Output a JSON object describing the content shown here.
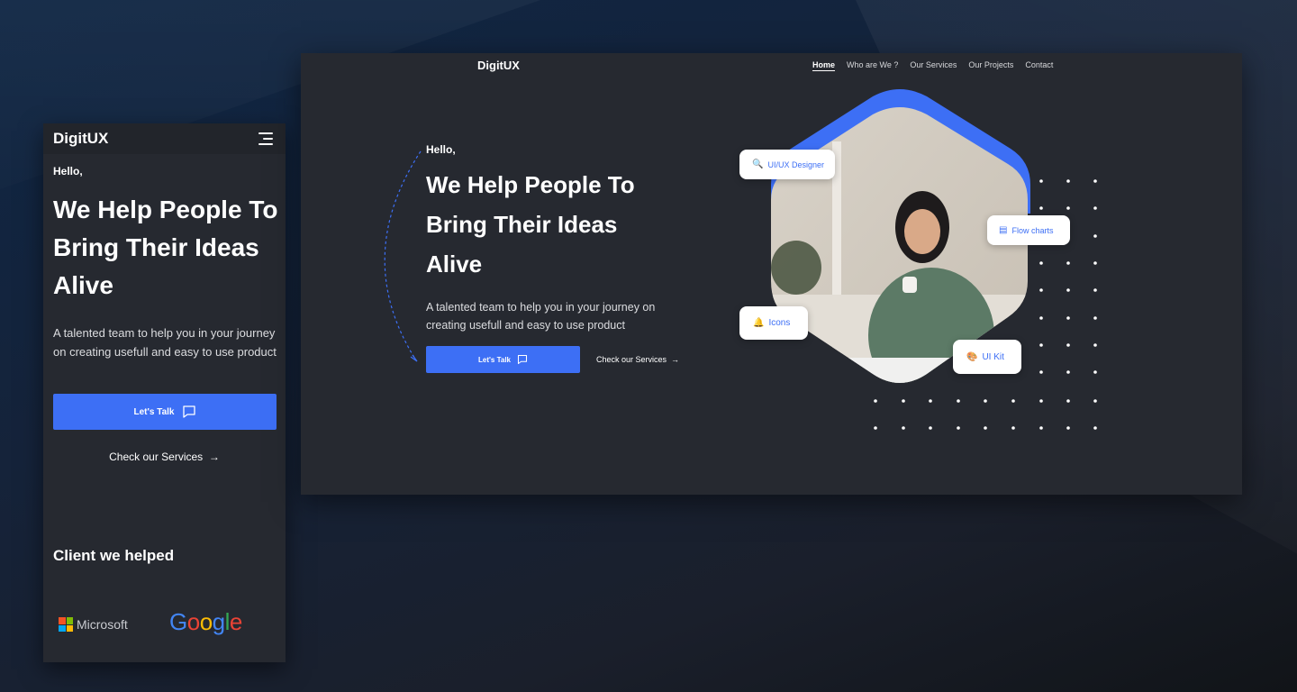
{
  "mobile": {
    "logo": "DigitUX",
    "hello": "Hello,",
    "title": "We Help People To Bring Their Ideas Alive",
    "description": "A talented team to help you in your journey on creating usefull and easy to use product",
    "cta_button": "Let's Talk",
    "services_link": "Check our Services",
    "clients_heading": "Client we helped",
    "clients": [
      "Microsoft",
      "Google"
    ]
  },
  "desktop": {
    "logo": "DigitUX",
    "nav": [
      "Home",
      "Who are We ?",
      "Our Services",
      "Our Projects",
      "Contact"
    ],
    "active_nav": "Home",
    "hello": "Hello,",
    "title": "We Help People To Bring Their Ideas Alive",
    "description": "A talented team to help you in your journey on creating usefull and easy to use product",
    "cta_button": "Let's Talk",
    "services_link": "Check our Services",
    "tags": [
      "UI/UX Designer",
      "Flow charts",
      "Icons",
      "UI Kit"
    ]
  },
  "colors": {
    "accent": "#3d6ff5",
    "panel": "#262930"
  }
}
